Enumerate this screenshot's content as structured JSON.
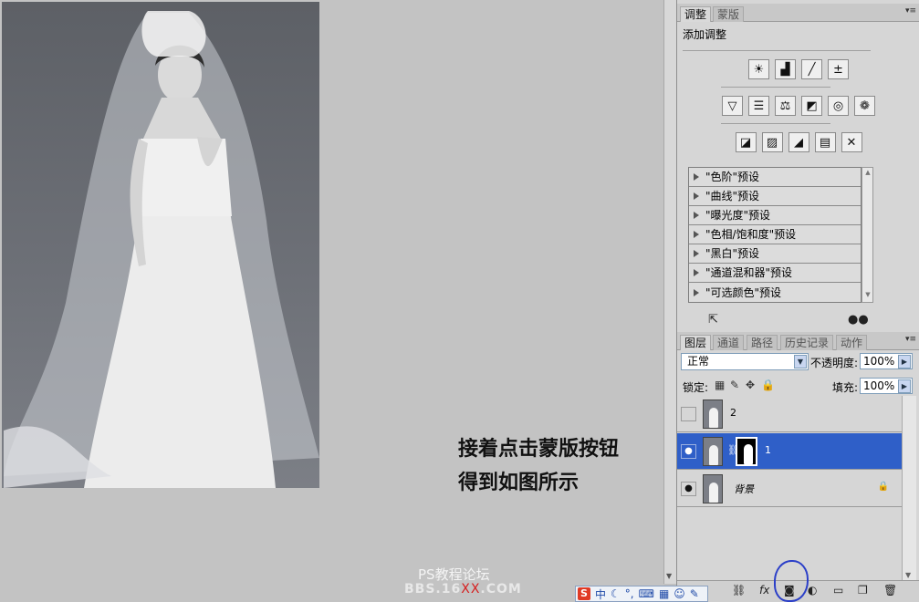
{
  "canvas": {
    "caption_line1": "接着点击蒙版按钮",
    "caption_line2": "得到如图所示",
    "watermark": "PS教程论坛",
    "watermark_url_prefix": "BBS.16",
    "watermark_url_red": "XX",
    "watermark_url_suffix": ".COM"
  },
  "adjust_panel": {
    "tabs": [
      "调整",
      "蒙版"
    ],
    "title": "添加调整",
    "row1_icons": [
      "brightness-contrast-icon",
      "levels-icon",
      "curves-icon",
      "exposure-icon"
    ],
    "row2_icons": [
      "vibrance-icon",
      "hue-saturation-icon",
      "color-balance-icon",
      "black-white-icon",
      "photo-filter-icon",
      "channel-mixer-icon"
    ],
    "row3_icons": [
      "invert-icon",
      "posterize-icon",
      "threshold-icon",
      "gradient-map-icon",
      "selective-color-icon"
    ],
    "presets": [
      "\"色阶\"预设",
      "\"曲线\"预设",
      "\"曝光度\"预设",
      "\"色相/饱和度\"预设",
      "\"黑白\"预设",
      "\"通道混和器\"预设",
      "\"可选颜色\"预设"
    ]
  },
  "layers_panel": {
    "tabs": [
      "图层",
      "通道",
      "路径",
      "历史记录",
      "动作"
    ],
    "blend_mode": "正常",
    "opacity_label": "不透明度:",
    "opacity_value": "100%",
    "lock_label": "锁定:",
    "fill_label": "填充:",
    "fill_value": "100%",
    "layers": [
      {
        "name": "2",
        "visible": false,
        "selected": false
      },
      {
        "name": "1",
        "visible": true,
        "selected": true
      },
      {
        "name": "背景",
        "visible": true,
        "selected": false
      }
    ],
    "toolbar_icons": [
      "link-layers-icon",
      "fx-icon",
      "add-mask-icon",
      "adjustment-layer-icon",
      "group-icon",
      "new-layer-icon",
      "delete-layer-icon"
    ]
  },
  "ime": {
    "logo": "S",
    "mode": "中"
  },
  "colors": {
    "selection": "#2f5fc8",
    "annotation_circle": "#2b3fc8"
  }
}
